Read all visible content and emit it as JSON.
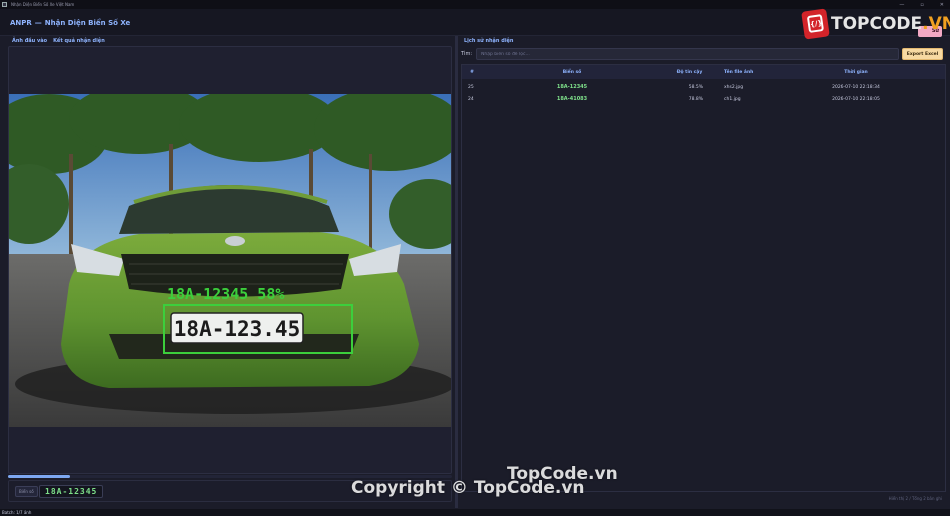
{
  "window": {
    "title": "Nhận Diện Biển Số Xe Việt Nam",
    "min": "—",
    "max": "▫",
    "close": "✕"
  },
  "header": {
    "brand": "ANPR",
    "separator": "—",
    "subtitle": "Nhận Diện Biển Số Xe",
    "pill": "Sử"
  },
  "logo": {
    "badge_text": "{/}",
    "text_a": "TOPCODE",
    "text_b": ".VN"
  },
  "left": {
    "tabs": [
      "Ảnh đầu vào",
      "Kết quả nhận diện"
    ],
    "overlay_text": "18A-12345 58%",
    "plate_in_photo": "18A-123.45",
    "progress": 0.14,
    "plate_label": "Biển số",
    "plate_value": "18A-12345"
  },
  "right": {
    "section_title": "Lịch sử nhận diện",
    "search_label": "Tìm:",
    "search_placeholder": "Nhập biển số để lọc...",
    "export_label": "Export Excel",
    "columns": [
      "#",
      "Biển số",
      "Độ tin cậy",
      "Tên file ảnh",
      "Thời gian"
    ],
    "rows": [
      {
        "idx": "25",
        "plate": "18A-12345",
        "conf": "58.5%",
        "file": "xhs2.jpg",
        "time": "2026-07-10 22:18:34"
      },
      {
        "idx": "24",
        "plate": "18A-41083",
        "conf": "78.8%",
        "file": "ch1.jpg",
        "time": "2026-07-10 22:18:05"
      }
    ],
    "footer": "Hiển thị 2 / Tổng 2 bản ghi"
  },
  "status": {
    "text": "Batch: 1/7 ảnh"
  },
  "watermark": {
    "line1": "TopCode.vn",
    "line2": "Copyright © TopCode.vn"
  },
  "colors": {
    "accent": "#8fb4ff",
    "plate_green": "#7ee08a",
    "export_bg": "#f7d9a2",
    "overlay_green": "#3ccf3c"
  }
}
